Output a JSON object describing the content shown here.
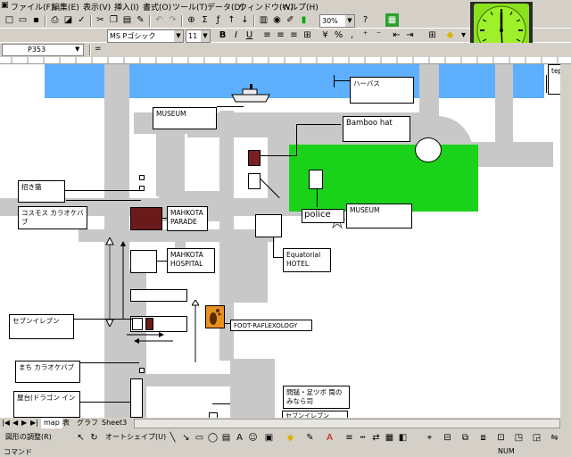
{
  "menu": [
    "ファイル(F)",
    "編集(E)",
    "表示(V)",
    "挿入(I)",
    "書式(O)",
    "ツール(T)",
    "データ(D)",
    "ウィンドウ(W)",
    "ヘルプ(H)"
  ],
  "toolbar": {
    "zoom": "30%",
    "font_name": "MS Pゴシック",
    "font_size": "11",
    "bold": "B",
    "italic": "I",
    "underline": "U",
    "currency": "¥",
    "percent": "%",
    "comma": ","
  },
  "formula_bar": {
    "name_box": "P353"
  },
  "map": {
    "labels": {
      "harbor": "ハーバス",
      "teppan": "teppa",
      "museum_top": "MUSEUM",
      "bamboo_hat": "Bamboo hat",
      "maneki": "招き猫",
      "cosmos_karaoke": "コスモス カラオケバブ",
      "mahkota_parade": "MAHKOTA PARADE",
      "museum_park": "MUSEUM",
      "police": "police",
      "mahkota_hospital": "MAHKOTA HOSPITAL",
      "equatorial_hotel": "Equatorial HOTEL",
      "seven_eleven_left": "セブンイレブン",
      "foot_reflexology": "FOOT-RAFLEXOLOGY",
      "machi_karaoke": "まち カラオケバブ",
      "yatai_dragon": "屋台(ドラゴン イン",
      "tsubo_shop": "問鎚・足ツボ 筒のみなら司",
      "seven_eleven_bottom": "セブンイレブン"
    }
  },
  "sheet_tabs": [
    "map",
    "表",
    "グラフ",
    "Sheet3"
  ],
  "draw_toolbar": {
    "adjust": "図形の調整(R)",
    "autoshape": "オートシェイプ(U)"
  },
  "status": {
    "left": "コマンド",
    "right": "NUM"
  }
}
